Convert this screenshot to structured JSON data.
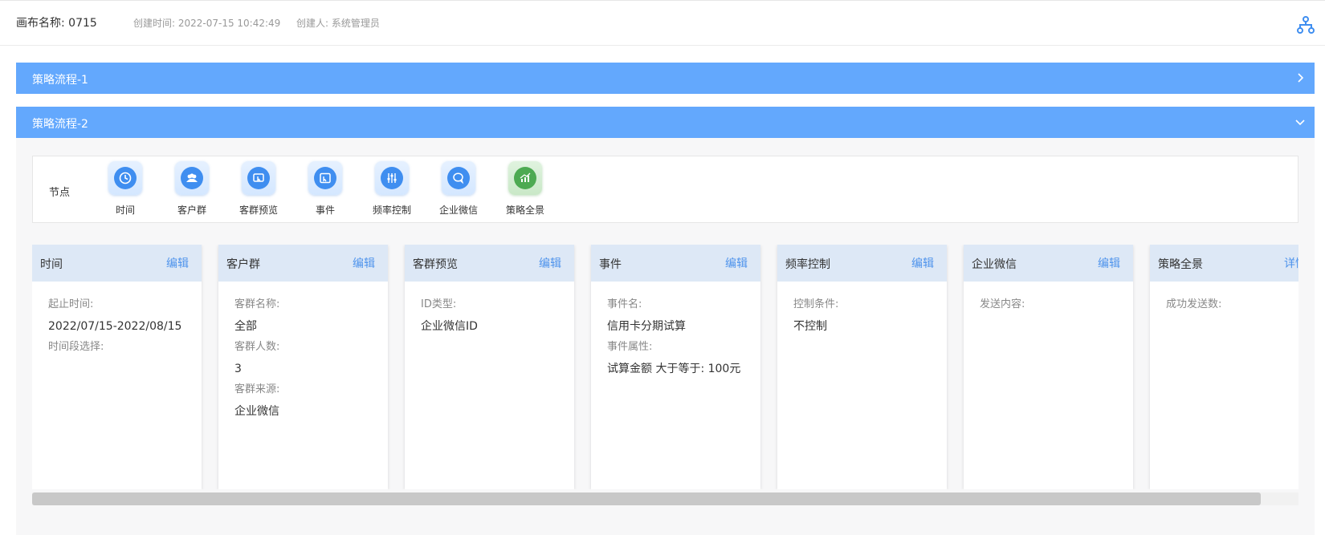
{
  "header": {
    "canvas_name": "画布名称: 0715",
    "created_time": "创建时间: 2022-07-15 10:42:49",
    "creator": "创建人: 系统管理员",
    "icon": "org-chart-icon"
  },
  "panels": [
    {
      "title": "策略流程-1",
      "state": "collapsed"
    },
    {
      "title": "策略流程-2",
      "state": "expanded"
    }
  ],
  "nodebar": {
    "label": "节点",
    "nodes": [
      {
        "label": "时间",
        "icon": "clock-icon"
      },
      {
        "label": "客户群",
        "icon": "users-icon"
      },
      {
        "label": "客群预览",
        "icon": "preview-icon"
      },
      {
        "label": "事件",
        "icon": "event-icon"
      },
      {
        "label": "频率控制",
        "icon": "sliders-icon"
      },
      {
        "label": "企业微信",
        "icon": "chat-icon"
      },
      {
        "label": "策略全景",
        "icon": "chart-icon"
      }
    ]
  },
  "cards": [
    {
      "title": "时间",
      "action": "编辑",
      "fields": [
        {
          "label": "起止时间:",
          "value": "2022/07/15-2022/08/15"
        },
        {
          "label": "时间段选择:",
          "value": ""
        }
      ]
    },
    {
      "title": "客户群",
      "action": "编辑",
      "fields": [
        {
          "label": "客群名称:",
          "value": "全部"
        },
        {
          "label": "客群人数:",
          "value": "3"
        },
        {
          "label": "客群来源:",
          "value": "企业微信"
        }
      ]
    },
    {
      "title": "客群预览",
      "action": "编辑",
      "fields": [
        {
          "label": "ID类型:",
          "value": "企业微信ID"
        }
      ]
    },
    {
      "title": "事件",
      "action": "编辑",
      "fields": [
        {
          "label": "事件名:",
          "value": "信用卡分期试算"
        },
        {
          "label": "事件属性:",
          "value": "试算金额 大于等于: 100元"
        }
      ]
    },
    {
      "title": "频率控制",
      "action": "编辑",
      "fields": [
        {
          "label": "控制条件:",
          "value": "不控制"
        }
      ]
    },
    {
      "title": "企业微信",
      "action": "编辑",
      "fields": [
        {
          "label": "发送内容:",
          "value": ""
        }
      ]
    },
    {
      "title": "策略全景",
      "action": "详情",
      "fields": [
        {
          "label": "成功发送数:",
          "value": ""
        }
      ]
    }
  ],
  "scrollbar": {
    "visible_fraction": 0.97
  },
  "colors": {
    "accent": "#63a8fd",
    "link": "#4e93ec",
    "card_header": "#dde8f6"
  }
}
